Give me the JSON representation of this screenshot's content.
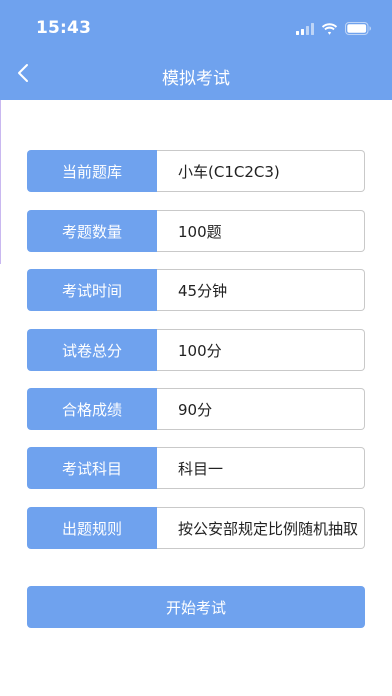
{
  "status_bar": {
    "time": "15:43",
    "icons": [
      "cellular-signal-icon",
      "wifi-icon",
      "battery-icon"
    ]
  },
  "nav": {
    "back_icon": "chevron-left-icon",
    "title": "模拟考试"
  },
  "colors": {
    "primary": "#6fa2ee",
    "text": "#222222",
    "border": "#c9c9c9"
  },
  "info": [
    {
      "label": "当前题库",
      "value": "小车(C1C2C3)"
    },
    {
      "label": "考题数量",
      "value": "100题"
    },
    {
      "label": "考试时间",
      "value": "45分钟"
    },
    {
      "label": "试卷总分",
      "value": "100分"
    },
    {
      "label": "合格成绩",
      "value": "90分"
    },
    {
      "label": "考试科目",
      "value": "科目一"
    },
    {
      "label": "出题规则",
      "value": "按公安部规定比例随机抽取"
    }
  ],
  "start_button": {
    "label": "开始考试"
  }
}
